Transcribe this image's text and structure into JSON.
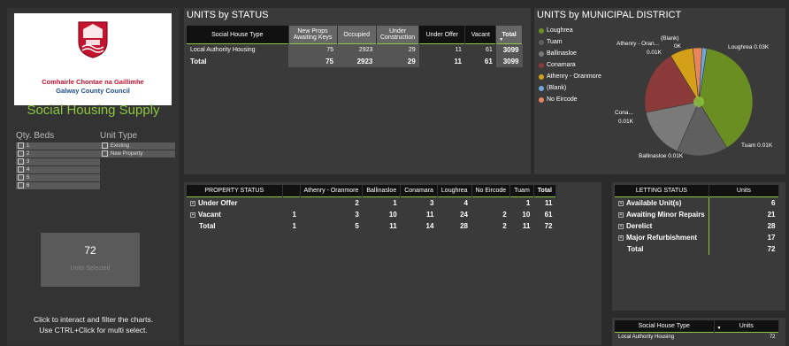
{
  "logo": {
    "org_line1": "Comhairle Chontae na Gaillimhe",
    "org_line2": "Galway County Council"
  },
  "left": {
    "title": "Social Housing Supply",
    "qty_beds_label": "Qty. Beds",
    "qty_beds": [
      "1",
      "2",
      "3",
      "4",
      "5",
      "6"
    ],
    "unit_type_label": "Unit Type",
    "unit_types": [
      "Existing",
      "New Property"
    ],
    "card_value": "72",
    "card_label": "Units Selected",
    "help_line1": "Click to interact and filter the charts.",
    "help_line2": "Use CTRL+Click for multi select."
  },
  "units_by_status": {
    "title": "UNITS by STATUS",
    "headers": [
      "Social House Type",
      "New Props Awaiting Keys",
      "Occupied",
      "Under Construction",
      "Under Offer",
      "Vacant",
      "Total"
    ],
    "row": [
      "Local Authority Housing",
      "75",
      "2923",
      "29",
      "11",
      "61",
      "3099"
    ],
    "total": [
      "Total",
      "75",
      "2923",
      "29",
      "11",
      "61",
      "3099"
    ]
  },
  "units_by_district": {
    "title": "UNITS by MUNICIPAL DISTRICT",
    "legend": [
      {
        "label": "Loughrea",
        "color": "#6b8e23"
      },
      {
        "label": "Tuam",
        "color": "#5f5f5f"
      },
      {
        "label": "Ballinasloe",
        "color": "#7a7a7a"
      },
      {
        "label": "Conamara",
        "color": "#8b3a3a"
      },
      {
        "label": "Athenry - Oranmore",
        "color": "#d4a017"
      },
      {
        "label": "(Blank)",
        "color": "#6fa8dc"
      },
      {
        "label": "No Eircode",
        "color": "#e8855a"
      }
    ],
    "labels": {
      "athenry": "Athenry - Oran...",
      "athenry_val": "0.01K",
      "blank": "(Blank)",
      "blank_val": "0K",
      "loughrea": "Loughrea 0.03K",
      "conamara": "Cona...",
      "conamara_val": "0.01K",
      "tuam": "Tuam 0.01K",
      "ballinasloe": "Ballinasloe 0.01K"
    }
  },
  "property_status": {
    "headers": [
      "PROPERTY STATUS",
      "",
      "Athenry - Oranmore",
      "Ballinasloe",
      "Conamara",
      "Loughrea",
      "No Eircode",
      "Tuam",
      "Total"
    ],
    "rows": [
      [
        "Under Offer",
        "",
        "2",
        "1",
        "3",
        "4",
        "",
        "1",
        "11"
      ],
      [
        "Vacant",
        "1",
        "3",
        "10",
        "11",
        "24",
        "2",
        "10",
        "61"
      ]
    ],
    "total": [
      "Total",
      "1",
      "5",
      "11",
      "14",
      "28",
      "2",
      "11",
      "72"
    ]
  },
  "letting_status": {
    "headers": [
      "LETTING STATUS",
      "Units"
    ],
    "rows": [
      [
        "Available Unit(s)",
        "6"
      ],
      [
        "Awaiting Minor Repairs",
        "21"
      ],
      [
        "Derelict",
        "28"
      ],
      [
        "Major Refurbishment",
        "17"
      ]
    ],
    "total": [
      "Total",
      "72"
    ]
  },
  "social_house_type": {
    "headers": [
      "Social House Type",
      "Units"
    ],
    "row": [
      "Local Authority Housing",
      "72"
    ]
  },
  "chart_data": {
    "type": "pie",
    "title": "UNITS by MUNICIPAL DISTRICT",
    "categories": [
      "Loughrea",
      "Tuam",
      "Ballinasloe",
      "Conamara",
      "Athenry - Oranmore",
      "(Blank)",
      "No Eircode"
    ],
    "values": [
      28,
      11,
      11,
      14,
      5,
      1,
      2
    ]
  }
}
